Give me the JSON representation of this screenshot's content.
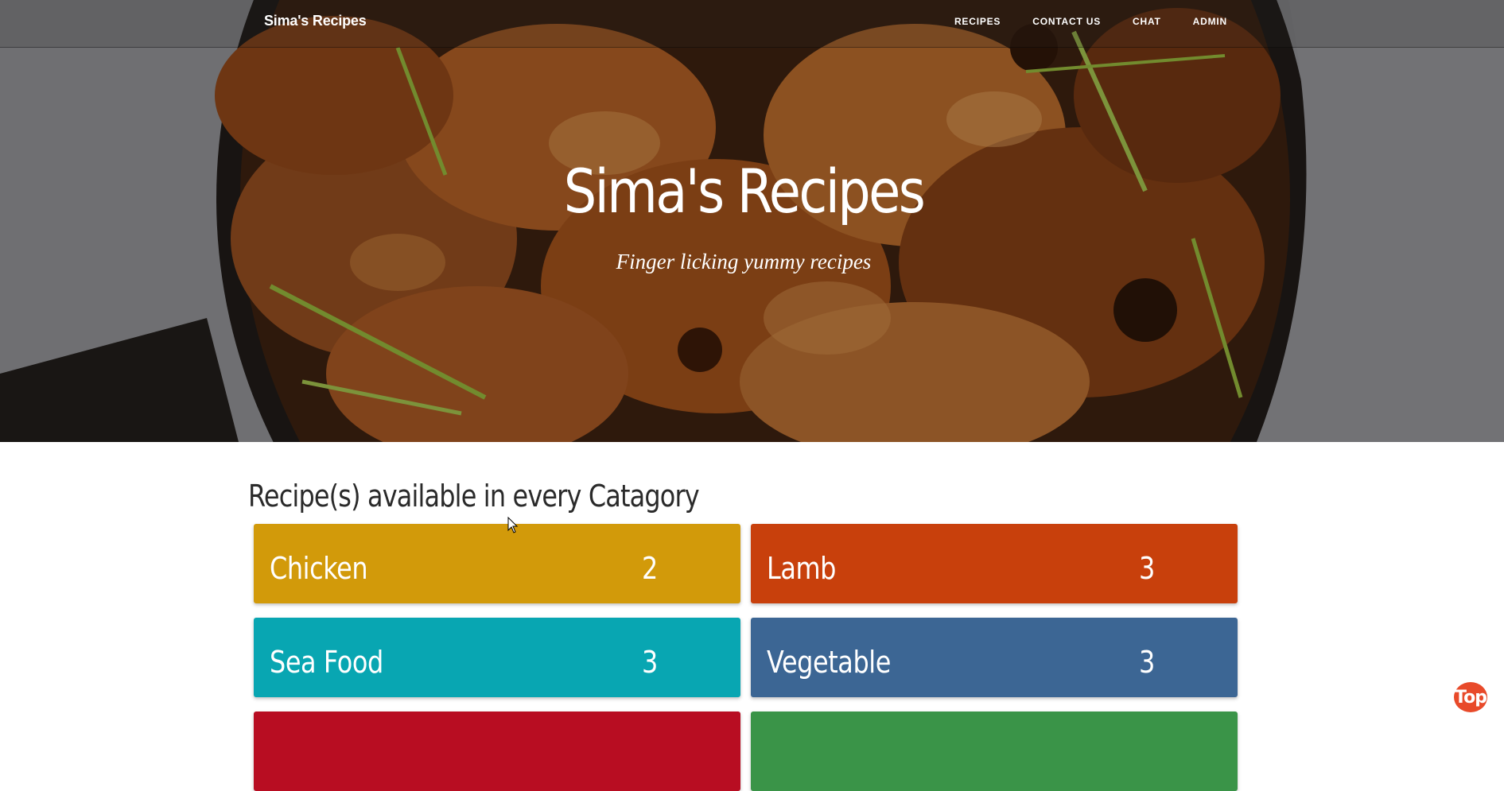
{
  "site": {
    "brand": "Sima's Recipes"
  },
  "nav": {
    "items": [
      {
        "label": "RECIPES"
      },
      {
        "label": "CONTACT US"
      },
      {
        "label": "CHAT"
      },
      {
        "label": "ADMIN"
      }
    ]
  },
  "hero": {
    "title": "Sima's Recipes",
    "subtitle": "Finger licking yummy recipes",
    "image": "roast-chicken-skillet-photo"
  },
  "categories_section": {
    "heading": "Recipe(s) available in every Catagory",
    "items": [
      {
        "name": "Chicken",
        "count": "2",
        "color": "#d29a0a"
      },
      {
        "name": "Lamb",
        "count": "3",
        "color": "#c8400c"
      },
      {
        "name": "Sea Food",
        "count": "3",
        "color": "#08a6b2"
      },
      {
        "name": "Vegetable",
        "count": "3",
        "color": "#3c6694"
      },
      {
        "name": "",
        "count": "",
        "color": "#b80d22"
      },
      {
        "name": "",
        "count": "",
        "color": "#3a9448"
      }
    ]
  },
  "top_button": {
    "label": "Top",
    "color": "#e84a2a"
  }
}
